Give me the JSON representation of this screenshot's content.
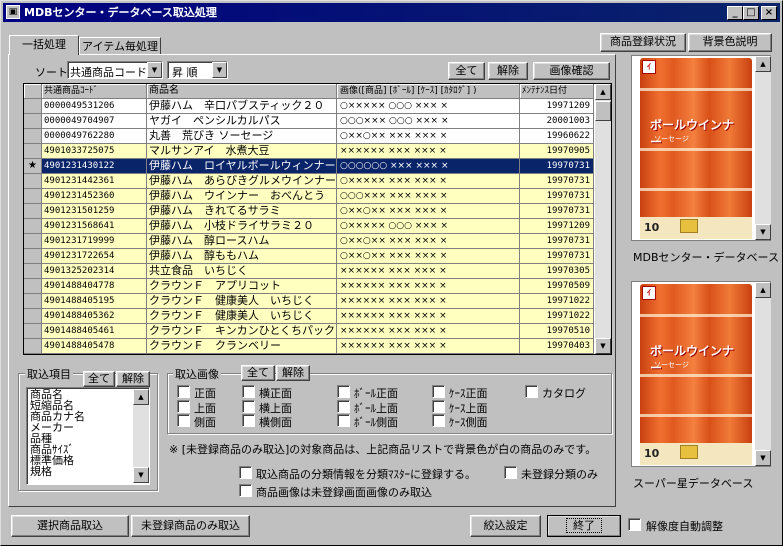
{
  "window": {
    "title": "MDBセンター・データベース取込処理",
    "app_icon": "window-app-icon",
    "controls": {
      "minimize": "_",
      "maximize": "□",
      "close": "×"
    }
  },
  "tabs": [
    "一括処理",
    "アイテム毎処理"
  ],
  "top_buttons": {
    "registration_status": "商品登録状況",
    "bg_color_help": "背景色説明"
  },
  "sort": {
    "label": "ソート",
    "field_value": "共通商品コード",
    "order_value": "昇 順"
  },
  "grid_buttons": {
    "all": "全て",
    "clear": "解除",
    "image_check": "画像確認"
  },
  "grid": {
    "columns": [
      "共通商品ｺｰﾄﾞ",
      "商品名",
      "画像([商品] [ﾎﾞｰﾙ] [ｹｰｽ] [ｶﾀﾛｸﾞ] )",
      "ﾒﾝﾃﾅﾝｽ日付"
    ],
    "rows": [
      {
        "mark": "",
        "code": "0000049531206",
        "name": "伊藤ハム　辛口パブスティック２０",
        "images": "○××××× ○○○ ××× ×",
        "date": "19971209",
        "style": "wht"
      },
      {
        "mark": "",
        "code": "0000049704907",
        "name": "ヤガイ　ペンシルカルパス",
        "images": "○○○××× ○○○ ××× ×",
        "date": "20001003",
        "style": "wht"
      },
      {
        "mark": "",
        "code": "0000049762280",
        "name": "丸善　荒びき ソーセージ",
        "images": "○××○×× ××× ××× ×",
        "date": "19960622",
        "style": "wht"
      },
      {
        "mark": "",
        "code": "4901033725075",
        "name": "マルサンアイ　水煮大豆",
        "images": "×××××× ××× ××× ×",
        "date": "19970905",
        "style": "yel"
      },
      {
        "mark": "★",
        "code": "4901231430122",
        "name": "伊藤ハム　ロイヤルボールウィンナー",
        "images": "○○○○○○ ××× ××× ×",
        "date": "19970731",
        "style": "sel"
      },
      {
        "mark": "",
        "code": "4901231442361",
        "name": "伊藤ハム　あらびきグルメウインナー",
        "images": "○××××× ××× ××× ×",
        "date": "19970731",
        "style": "yel"
      },
      {
        "mark": "",
        "code": "4901231452360",
        "name": "伊藤ハム　ウインナー　おべんとう",
        "images": "○○○××× ××× ××× ×",
        "date": "19970731",
        "style": "yel"
      },
      {
        "mark": "",
        "code": "4901231501259",
        "name": "伊藤ハム　きれてるサラミ",
        "images": "○××○×× ××× ××× ×",
        "date": "19970731",
        "style": "yel"
      },
      {
        "mark": "",
        "code": "4901231568641",
        "name": "伊藤ハム　小枝ドライサラミ２０",
        "images": "○××××× ○○○ ××× ×",
        "date": "19971209",
        "style": "yel"
      },
      {
        "mark": "",
        "code": "4901231719999",
        "name": "伊藤ハム　醇ロースハム",
        "images": "○××○×× ××× ××× ×",
        "date": "19970731",
        "style": "yel"
      },
      {
        "mark": "",
        "code": "4901231722654",
        "name": "伊藤ハム　醇ももハム",
        "images": "○××○×× ××× ××× ×",
        "date": "19970731",
        "style": "yel"
      },
      {
        "mark": "",
        "code": "4901325202314",
        "name": "共立食品　いちじく",
        "images": "×××××× ××× ××× ×",
        "date": "19970305",
        "style": "yel"
      },
      {
        "mark": "",
        "code": "4901488404778",
        "name": "クラウンＦ　アプリコット",
        "images": "×××××× ××× ××× ×",
        "date": "19970509",
        "style": "yel"
      },
      {
        "mark": "",
        "code": "4901488405195",
        "name": "クラウンＦ　健康美人　いちじく",
        "images": "×××××× ××× ××× ×",
        "date": "19971022",
        "style": "yel"
      },
      {
        "mark": "",
        "code": "4901488405362",
        "name": "クラウンＦ　健康美人　いちじく",
        "images": "×××××× ××× ××× ×",
        "date": "19971022",
        "style": "yel"
      },
      {
        "mark": "",
        "code": "4901488405461",
        "name": "クラウンＦ　キンカンひとくちパック",
        "images": "×××××× ××× ××× ×",
        "date": "19970510",
        "style": "yel"
      },
      {
        "mark": "",
        "code": "4901488405478",
        "name": "クラウンＦ　クランベリー",
        "images": "×××××× ××× ××× ×",
        "date": "19970403",
        "style": "yel"
      }
    ]
  },
  "import_items": {
    "label": "取込項目",
    "all": "全て",
    "clear": "解除",
    "items": [
      "商品名",
      "短縮品名",
      "商品カナ名",
      "メーカー",
      "品種",
      "商品ｻｲｽﾞ",
      "標準価格",
      "規格"
    ]
  },
  "import_images": {
    "label": "取込画像",
    "all": "全て",
    "clear": "解除",
    "options": [
      [
        "正面",
        "横正面",
        "ﾎﾞｰﾙ正面",
        "ｹｰｽ正面",
        "カタログ"
      ],
      [
        "上面",
        "横上面",
        "ﾎﾞｰﾙ上面",
        "ｹｰｽ上面"
      ],
      [
        "側面",
        "横側面",
        "ﾎﾞｰﾙ側面",
        "ｹｰｽ側面"
      ]
    ]
  },
  "note": "※ [未登録商品のみ取込]の対象商品は、上記商品リストで背景色が白の商品のみです。",
  "checks": {
    "register_category": "取込商品の分類情報を分類ﾏｽﾀｰに登録する。",
    "unregistered_category_only": "未登録分類のみ",
    "unregistered_images_only": "商品画像は未登録画面画像のみ取込"
  },
  "bottom_buttons": {
    "import_selected": "選択商品取込",
    "import_unregistered": "未登録商品のみ取込",
    "filter_settings": "絞込設定",
    "exit": "終了"
  },
  "auto_resolution": "解像度自動調整",
  "previews": {
    "top_caption": "MDBセンター・データベース",
    "bottom_caption": "スーパー星データベース",
    "package_brand": "ボールウインナー",
    "package_sub": "ソーセージ",
    "package_count": "10"
  }
}
